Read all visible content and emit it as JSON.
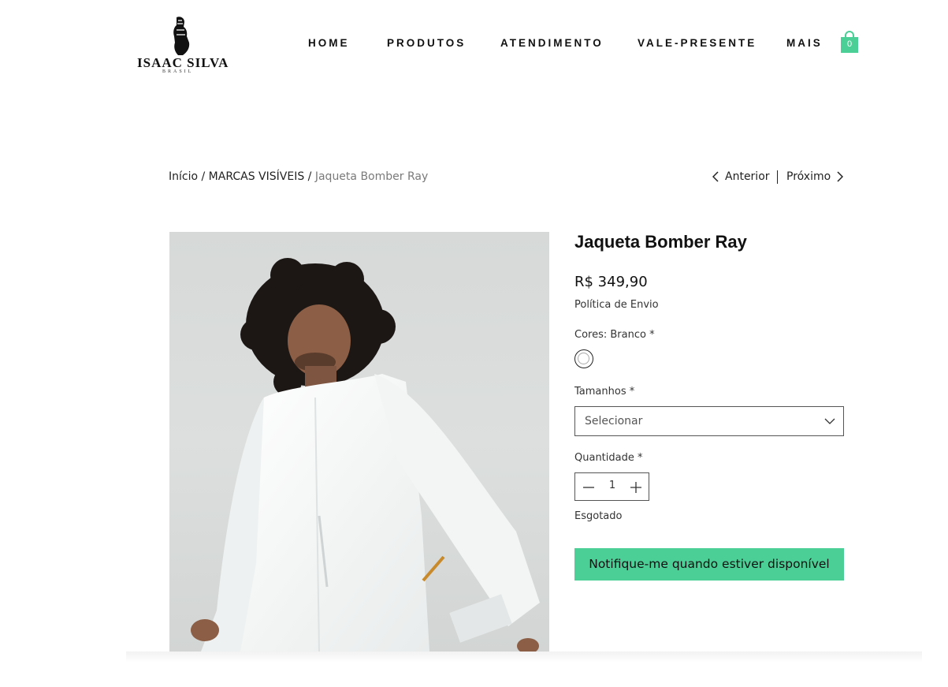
{
  "brand": {
    "name": "ISAAC SILVA",
    "tagline": "BRASIL"
  },
  "nav": {
    "items": [
      {
        "label": "HOME"
      },
      {
        "label": "PRODUTOS"
      },
      {
        "label": "ATENDIMENTO"
      },
      {
        "label": "VALE-PRESENTE"
      },
      {
        "label": "MAIS"
      }
    ]
  },
  "cart": {
    "count": "0",
    "icon": "shopping-bag-icon",
    "color": "#4ccf96"
  },
  "breadcrumb": {
    "home": "Início",
    "sep1": " / ",
    "category": "MARCAS VISÍVEIS",
    "sep2": " / ",
    "current": "Jaqueta Bomber Ray"
  },
  "pager": {
    "prev": "Anterior",
    "next": "Próximo"
  },
  "product": {
    "title": "Jaqueta Bomber Ray",
    "price": "R$ 349,90",
    "shipping_link": "Política de Envio",
    "color_label": "Cores: Branco *",
    "color_swatch": "#ffffff",
    "size_label": "Tamanhos *",
    "size_placeholder": "Selecionar",
    "quantity_label": "Quantidade *",
    "quantity": "1",
    "stock_status": "Esgotado",
    "notify_button": "Notifique-me quando estiver disponível",
    "accent_color": "#4ccf96"
  }
}
